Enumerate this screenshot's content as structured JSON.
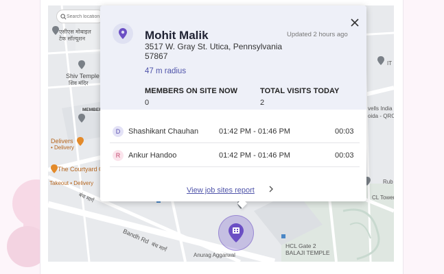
{
  "search": {
    "placeholder": "Search location"
  },
  "map_labels": {
    "top_left": "एसीएस मोबाइल",
    "top_left_2": "टेक सॉल्यूशन",
    "shiv_temple": "Shiv Temple",
    "shiv_temple_hi": "शिव मंदिर",
    "members_visits": "MEMBERS VISITS",
    "delivers": "Delivers",
    "delivery": "• Delivery",
    "courtyard": "The Courtyard Cafe",
    "takeout": "Takeout • Delivery",
    "bandh_road_hi": "बंध मार्ग",
    "bandh_road": "Bandh Rd",
    "bandh_road_hi2": "बंध मार्ग",
    "anurag": "Anurag Aggarwal",
    "hcl_gate": "HCL Gate 2",
    "balaji": "BALAJI TEMPLE",
    "hcl_tower": "CL Tower",
    "rub": "Rub",
    "wells_india": "vells India",
    "oida": "oida - QRC",
    "it": "IT"
  },
  "popup": {
    "name": "Mohit Malik",
    "address": "3517 W. Gray St. Utica, Pennsylvania 57867",
    "updated": "Updated 2 hours ago",
    "radius": "47 m radius",
    "members_on_site_label": "MEMBERS ON SITE NOW",
    "members_on_site_value": "0",
    "total_visits_label": "TOTAL VISITS TODAY",
    "total_visits_value": "2",
    "visits": [
      {
        "initial": "D",
        "name": "Shashikant Chauhan",
        "time": "01:42 PM - 01:46 PM",
        "duration": "00:03",
        "avatar_bg": "#e3e2f6",
        "avatar_fg": "#5a4fb0"
      },
      {
        "initial": "R",
        "name": "Ankur Handoo",
        "time": "01:42 PM - 01:46 PM",
        "duration": "00:03",
        "avatar_bg": "#fbe4ec",
        "avatar_fg": "#c2486f"
      }
    ],
    "report_link": "View job sites report"
  },
  "colors": {
    "accent": "#4e53a9",
    "marker": "#6b4fc4"
  }
}
